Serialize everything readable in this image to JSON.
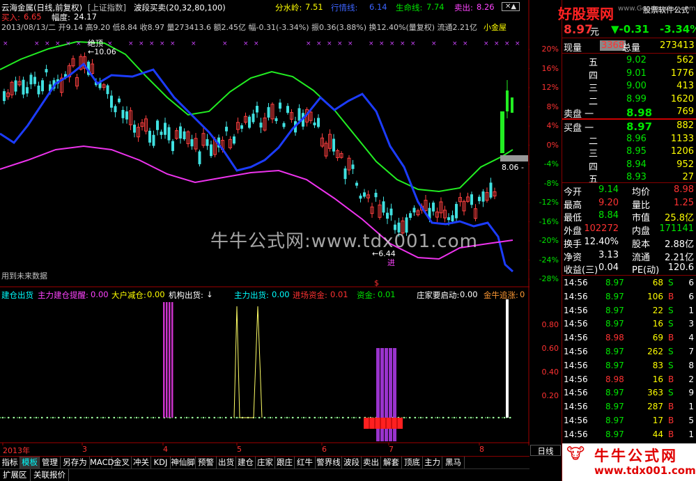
{
  "header": {
    "stock": "云海金属(日线,前复权)",
    "index": "[上证指数]",
    "formula": "波段买卖(20,32,80,100)",
    "fenshuiling_label": "分水岭:",
    "fenshuiling_val": "7.51",
    "hangqing_label": "行情线:",
    "hangqing_val": "6.14",
    "shengming_label": "生命线:",
    "shengming_val": "7.74",
    "maichu_label": "卖出:",
    "maichu_val": "8.26",
    "mairu_label": "买入:",
    "mairu_val": "6.65",
    "fudu_label": "幅度:",
    "fudu_val": "24.17",
    "info_line": "2013/08/13/二 开9.14 高9.20 低8.84 收8.97 量273413.6 额2.45亿 幅-0.31(-3.34%) 振0.36(3.88%) 换12.40%(量复权) 流通2.21亿",
    "xiaojin": "小金屋"
  },
  "annotations": {
    "juedin": "绝顶",
    "high_val": "←10.06",
    "low_val": "←6.44",
    "jin": "进",
    "right_val": "8.06 -",
    "future_note": "用到未来数据",
    "dollar": "$"
  },
  "watermark": "牛牛公式网:www.tdx001.com",
  "sub_header": {
    "jiancang": "建仓出货",
    "zhuli_jc": "主力建仓提醒:",
    "zhuli_jc_val": "0.00",
    "dahu": "大户减仓:",
    "dahu_val": "0.00",
    "jigou": "机构出货:",
    "jigou_val": "↓",
    "zhuli_ch": "主力出货:",
    "zhuli_ch_val": "0.00",
    "jinchang": "进场资金:",
    "jinchang_val": "0.01",
    "zijin": "资金:",
    "zijin_val": "0.01",
    "zhuangjia": "庄家要启动:",
    "zhuangjia_val": "0.00",
    "jinniu": "金牛追涨:",
    "jinniu_val": "0"
  },
  "axis_right": [
    "20%",
    "16%",
    "12%",
    "8%",
    "4%",
    "0%",
    "-4%",
    "-8%",
    "-12%",
    "-16%",
    "-20%",
    "-24%",
    "-28%"
  ],
  "axis_sub": [
    "0.80",
    "0.60",
    "0.40",
    "0.20"
  ],
  "axis_x": [
    "2013年",
    "3",
    "4",
    "5",
    "6",
    "7",
    "8"
  ],
  "quote": {
    "logo": "好股票网",
    "logo_url": "www.Goodgupiao.com",
    "logo_sub": "股票软件公式",
    "price": "8.97",
    "yuan": "元",
    "change": "▼-0.31",
    "pct": "-3.34%",
    "xianliang_l": "现量",
    "xianliang": "3368",
    "zongliang_l": "总量",
    "zongliang": "273413",
    "sell": [
      {
        "n": "五",
        "p": "9.02",
        "v": "562"
      },
      {
        "n": "四",
        "p": "9.01",
        "v": "1776"
      },
      {
        "n": "三",
        "p": "9.00",
        "v": "413"
      },
      {
        "n": "二",
        "p": "8.99",
        "v": "1620"
      },
      {
        "n": "卖盘 一",
        "p": "8.98",
        "v": "769"
      }
    ],
    "buy": [
      {
        "n": "买盘 一",
        "p": "8.97",
        "v": "882"
      },
      {
        "n": "二",
        "p": "8.96",
        "v": "1133"
      },
      {
        "n": "三",
        "p": "8.95",
        "v": "1206"
      },
      {
        "n": "四",
        "p": "8.94",
        "v": "952"
      },
      {
        "n": "五",
        "p": "8.93",
        "v": "27"
      }
    ],
    "stats": [
      {
        "a": "今开",
        "av": "9.14",
        "b": "均价",
        "bv": "8.98"
      },
      {
        "a": "最高",
        "av": "9.20",
        "b": "量比",
        "bv": "1.25"
      },
      {
        "a": "最低",
        "av": "8.84",
        "b": "市值",
        "bv": "25.8亿"
      },
      {
        "a": "外盘",
        "av": "102272",
        "b": "内盘",
        "bv": "171141"
      },
      {
        "a": "换手",
        "av": "12.40%",
        "b": "股本",
        "bv": "2.88亿"
      },
      {
        "a": "净资",
        "av": "3.13",
        "b": "流通",
        "bv": "2.21亿"
      },
      {
        "a": "收益(三)",
        "av": "0.04",
        "b": "PE(动)",
        "bv": "120.6"
      }
    ],
    "ticks": [
      {
        "t": "14:56",
        "p": "8.97",
        "v": "68",
        "s": "S",
        "n": "6"
      },
      {
        "t": "14:56",
        "p": "8.97",
        "v": "106",
        "s": "B",
        "n": "6"
      },
      {
        "t": "14:56",
        "p": "8.97",
        "v": "22",
        "s": "S",
        "n": "1"
      },
      {
        "t": "14:56",
        "p": "8.97",
        "v": "16",
        "s": "S",
        "n": "3"
      },
      {
        "t": "14:56",
        "p": "8.98",
        "v": "69",
        "s": "B",
        "n": "4"
      },
      {
        "t": "14:56",
        "p": "8.97",
        "v": "262",
        "s": "S",
        "n": "7"
      },
      {
        "t": "14:56",
        "p": "8.97",
        "v": "83",
        "s": "S",
        "n": "8"
      },
      {
        "t": "14:56",
        "p": "8.98",
        "v": "16",
        "s": "B",
        "n": "2"
      },
      {
        "t": "14:56",
        "p": "8.97",
        "v": "363",
        "s": "S",
        "n": "9"
      },
      {
        "t": "14:56",
        "p": "8.97",
        "v": "287",
        "s": "B",
        "n": "1"
      },
      {
        "t": "14:56",
        "p": "8.97",
        "v": "17",
        "s": "B",
        "n": "5"
      },
      {
        "t": "14:56",
        "p": "8.97",
        "v": "44",
        "s": "B",
        "n": "1"
      }
    ],
    "period": "日线",
    "brand": "牛牛公式网",
    "brand_url": "www.tdx001.com"
  },
  "toolbar": [
    "指标",
    "模板",
    "管理",
    "另存为",
    "MACD",
    "金叉",
    "冲关",
    "KDJ",
    "神仙脚",
    "预警",
    "出货",
    "建仓",
    "庄家",
    "跟庄",
    "红牛",
    "警界线",
    "波段",
    "卖出",
    "解套",
    "顶底",
    "主力",
    "黑马"
  ],
  "bottom_tabs": [
    "扩展区",
    "关联报价"
  ]
}
